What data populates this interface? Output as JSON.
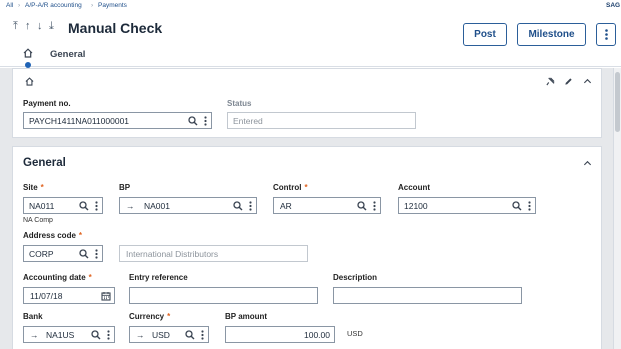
{
  "breadcrumb": {
    "items": [
      "All",
      "A/P-A/R accounting",
      "Payments"
    ],
    "brand": "SAG"
  },
  "header": {
    "nav_icons": [
      "first-record-icon",
      "previous-record-icon",
      "next-record-icon",
      "last-record-icon"
    ],
    "title": "Manual Check",
    "post_label": "Post",
    "milestone_label": "Milestone",
    "tab_general": "General"
  },
  "top_card": {
    "payment_no_label": "Payment no.",
    "payment_no_value": "PAYCH1411NA011000001",
    "status_label": "Status",
    "status_value": "Entered"
  },
  "general": {
    "section_title": "General",
    "site_label": "Site",
    "site_value": "NA011",
    "site_sub": "NA Comp",
    "bp_label": "BP",
    "bp_value": "NA001",
    "control_label": "Control",
    "control_value": "AR",
    "account_label": "Account",
    "account_value": "12100",
    "address_code_label": "Address code",
    "address_code_value": "CORP",
    "address_name_value": "International Distributors",
    "accounting_date_label": "Accounting date",
    "accounting_date_value": "11/07/18",
    "entry_reference_label": "Entry reference",
    "entry_reference_value": "",
    "description_label": "Description",
    "description_value": "",
    "bank_label": "Bank",
    "bank_value": "NA1US",
    "currency_label": "Currency",
    "currency_value": "USD",
    "bp_amount_label": "BP amount",
    "bp_amount_value": "100.00",
    "bp_amount_unit": "USD"
  },
  "colors": {
    "accent": "#1f4f8a",
    "required": "#e06421",
    "background": "#e6e8eb"
  }
}
